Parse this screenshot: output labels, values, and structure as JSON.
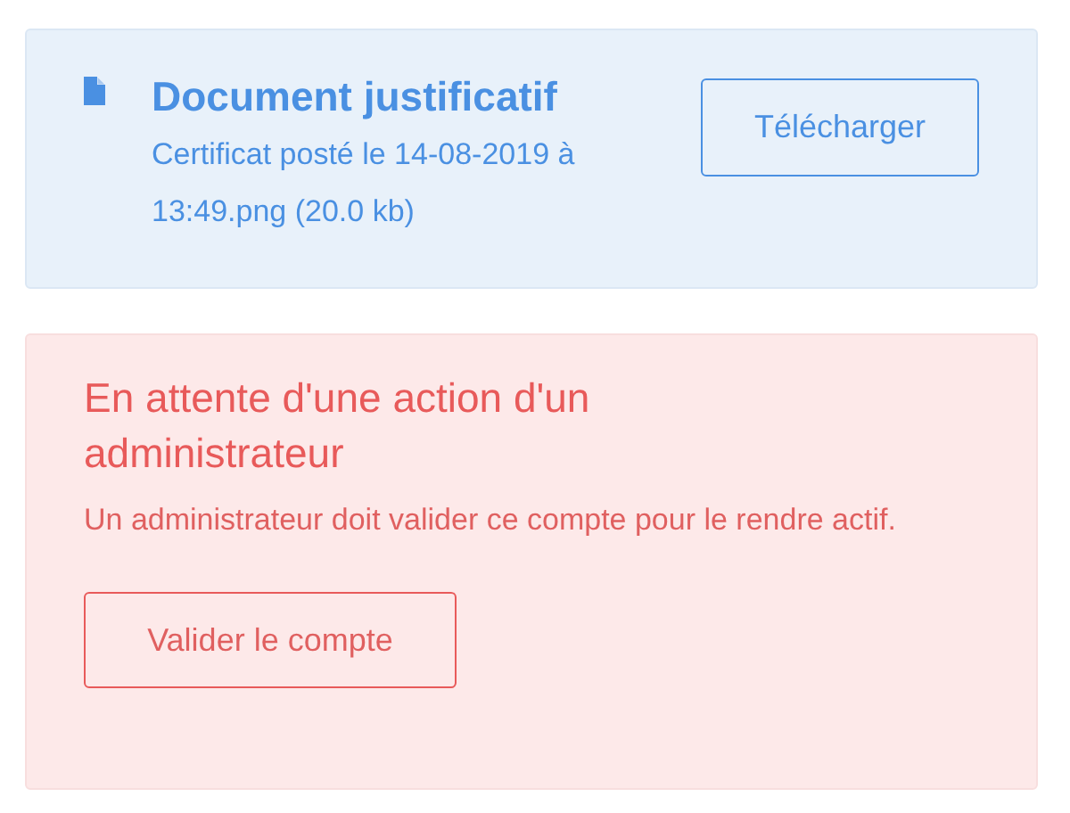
{
  "document": {
    "title": "Document justificatif",
    "description": "Certificat posté le 14-08-2019 à 13:49.png (20.0 kb)",
    "button": "Télécharger"
  },
  "alert": {
    "title": "En attente d'une action d'un administrateur",
    "message": "Un administrateur doit valider ce compte pour le rendre actif.",
    "button": "Valider le compte"
  }
}
